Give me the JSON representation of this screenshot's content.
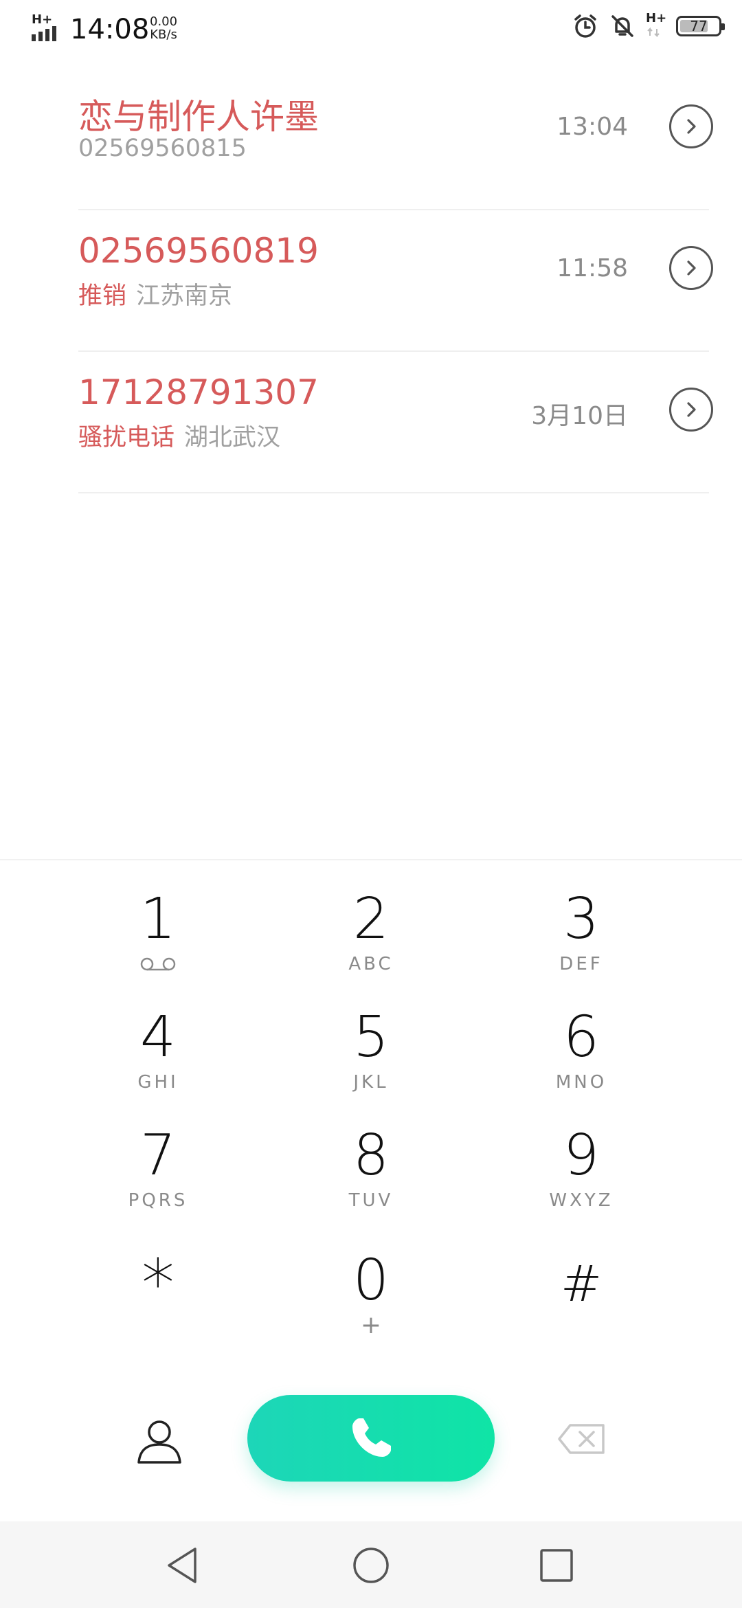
{
  "status_bar": {
    "network_left": "H+",
    "time": "14:08",
    "speed_value": "0.00",
    "speed_unit": "KB/s",
    "network_right": "H+",
    "battery": "77",
    "battery_level": 0.77,
    "icons": [
      "alarm-icon",
      "bell-off-icon",
      "signal-icon",
      "battery-icon"
    ]
  },
  "calls": [
    {
      "name": "恋与制作人许墨",
      "tag": "",
      "sub": "02569560815",
      "time": "13:04"
    },
    {
      "name": "02569560819",
      "tag": "推销",
      "sub": "江苏南京",
      "time": "11:58"
    },
    {
      "name": "17128791307",
      "tag": "骚扰电话",
      "sub": "湖北武汉",
      "time": "3月10日"
    }
  ],
  "colors": {
    "missed_red": "#d65a5a",
    "call_button_start": "#1dd6b8",
    "call_button_end": "#0fe4a6"
  },
  "dialpad": {
    "keys": [
      {
        "digit": "1",
        "letters": ""
      },
      {
        "digit": "2",
        "letters": "ABC"
      },
      {
        "digit": "3",
        "letters": "DEF"
      },
      {
        "digit": "4",
        "letters": "GHI"
      },
      {
        "digit": "5",
        "letters": "JKL"
      },
      {
        "digit": "6",
        "letters": "MNO"
      },
      {
        "digit": "7",
        "letters": "PQRS"
      },
      {
        "digit": "8",
        "letters": "TUV"
      },
      {
        "digit": "9",
        "letters": "WXYZ"
      },
      {
        "digit": "*",
        "letters": ""
      },
      {
        "digit": "0",
        "letters": "+"
      },
      {
        "digit": "#",
        "letters": ""
      }
    ]
  },
  "actions": {
    "left_icon": "contacts-icon",
    "center_icon": "phone-icon",
    "right_icon": "backspace-icon"
  },
  "nav": {
    "icons": [
      "back-icon",
      "home-icon",
      "recents-icon"
    ]
  }
}
